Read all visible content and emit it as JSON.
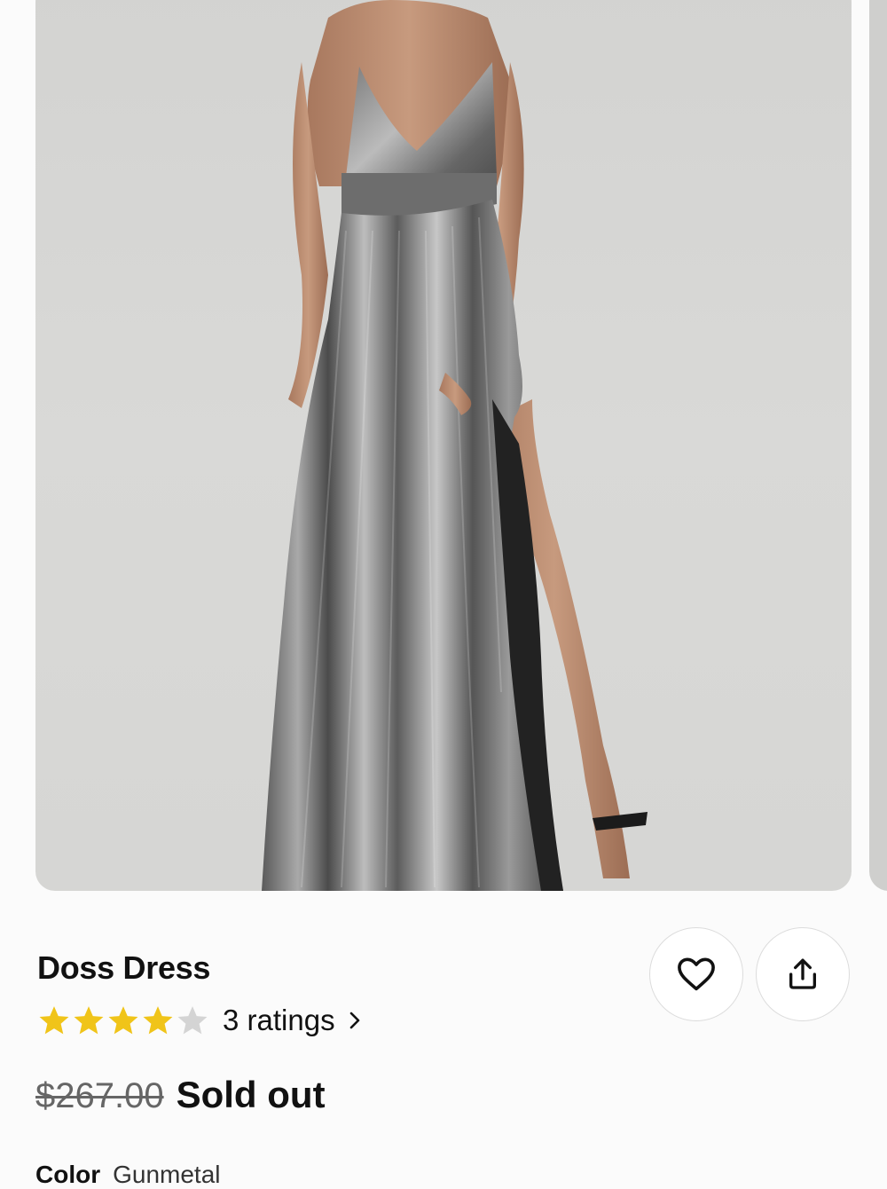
{
  "product": {
    "name": "Doss Dress",
    "rating_value": 4,
    "rating_max": 5,
    "ratings_label": "3 ratings",
    "original_price": "$267.00",
    "status": "Sold out",
    "color_label": "Color",
    "color_value": "Gunmetal"
  },
  "colors": {
    "star_filled": "#f0c419",
    "star_empty": "#d4d4d4",
    "text": "#111111"
  },
  "icons": {
    "favorite": "heart-icon",
    "share": "share-icon",
    "ratings_arrow": "chevron-right-icon"
  }
}
